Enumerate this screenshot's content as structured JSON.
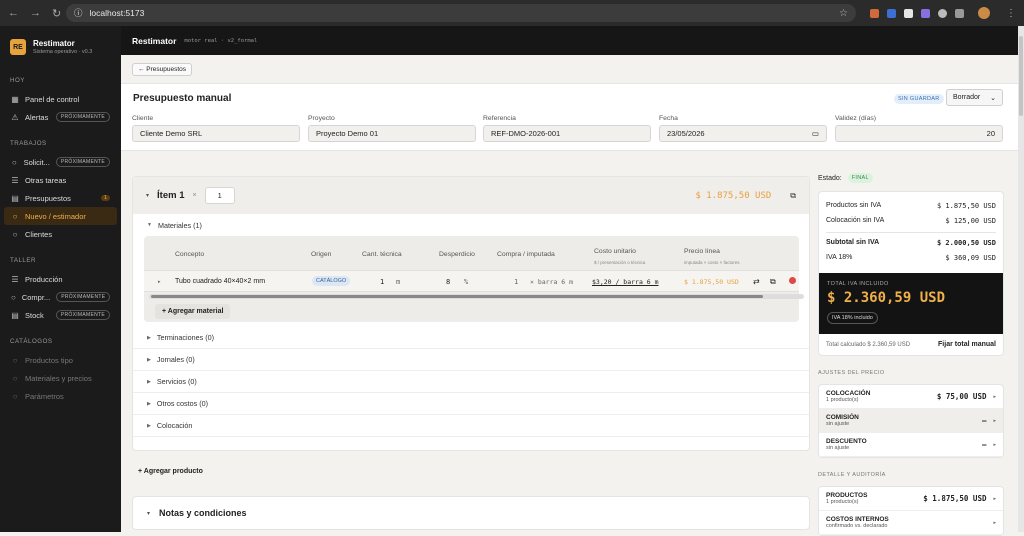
{
  "browser": {
    "url": "localhost:5173"
  },
  "sidebar": {
    "logo": "RE",
    "app_name": "Restimator",
    "app_sub": "Sistema operativo · v0.3",
    "sections": [
      {
        "title": "HOY",
        "items": [
          {
            "label": "Panel de control",
            "icon": "grid-icon",
            "state": "normal"
          },
          {
            "label": "Alertas",
            "icon": "alert-icon",
            "state": "normal",
            "pill": "PRÓXIMAMENTE"
          }
        ]
      },
      {
        "title": "TRABAJOS",
        "items": [
          {
            "label": "Solicit...",
            "icon": "circle-icon",
            "state": "normal",
            "pill": "PRÓXIMAMENTE"
          },
          {
            "label": "Otras tareas",
            "icon": "list-icon",
            "state": "normal"
          },
          {
            "label": "Presupuestos",
            "icon": "doc-icon",
            "state": "normal",
            "count": "1"
          },
          {
            "label": "Nuevo / estimador",
            "icon": "circle-icon",
            "state": "active"
          },
          {
            "label": "Clientes",
            "icon": "circle-icon",
            "state": "normal"
          }
        ]
      },
      {
        "title": "TALLER",
        "items": [
          {
            "label": "Producción",
            "icon": "list-icon",
            "state": "normal"
          },
          {
            "label": "Compr...",
            "icon": "circle-icon",
            "state": "normal",
            "pill": "PRÓXIMAMENTE"
          },
          {
            "label": "Stock",
            "icon": "doc-icon",
            "state": "normal",
            "pill": "PRÓXIMAMENTE"
          }
        ]
      },
      {
        "title": "CATÁLOGOS",
        "items": [
          {
            "label": "Productos tipo",
            "icon": "circle-icon",
            "state": "disabled"
          },
          {
            "label": "Materiales y precios",
            "icon": "circle-icon",
            "state": "disabled"
          },
          {
            "label": "Parámetros",
            "icon": "circle-icon",
            "state": "disabled"
          }
        ]
      }
    ]
  },
  "appbar": {
    "title": "Restimator",
    "sub": "motor real · v2_formal"
  },
  "main": {
    "back": "← Presupuestos",
    "title": "Presupuesto manual",
    "unsaved": "SIN GUARDAR",
    "status_select": "Borrador",
    "fields": {
      "cliente": {
        "label": "Cliente",
        "value": "Cliente Demo SRL"
      },
      "proyecto": {
        "label": "Proyecto",
        "value": "Proyecto Demo 01"
      },
      "referencia": {
        "label": "Referencia",
        "value": "REF-DMO-2026-001"
      },
      "fecha": {
        "label": "Fecha",
        "value": "23/05/2026"
      },
      "validez": {
        "label": "Validez (días)",
        "value": "20"
      }
    },
    "item": {
      "title": "Ítem 1",
      "qty": "1",
      "total": "$ 1.875,50 USD",
      "materials_title": "Materiales (1)",
      "columns": {
        "concepto": "Concepto",
        "origen": "Origen",
        "cant": "Cant. técnica",
        "desperdicio": "Desperdicio",
        "compra": "Compra / imputada",
        "costo": "Costo unitario",
        "costo_sub": "$ / presentación o técnica",
        "precio": "Precio línea",
        "precio_sub": "imputada × costo × factores"
      },
      "material_row": {
        "concepto": "Tubo cuadrado 40×40×2 mm",
        "origen": "CATÁLOGO",
        "cant": "1",
        "cant_unit": "m",
        "desperdicio": "8",
        "desp_unit": "%",
        "compra": "1",
        "compra_unit": "× barra 6 m",
        "costo": "$3,20 / barra 6 m",
        "precio": "$ 1.875,50 USD"
      },
      "add_material": "+ Agregar material",
      "sections": [
        "Terminaciones (0)",
        "Jornales (0)",
        "Servicios (0)",
        "Otros costos (0)",
        "Colocación"
      ]
    },
    "add_product": "+ Agregar producto",
    "notes": "Notas y condiciones"
  },
  "summary": {
    "estado_label": "Estado:",
    "estado": "FINAL",
    "lines": [
      {
        "label": "Productos sin IVA",
        "value": "$ 1.875,50 USD"
      },
      {
        "label": "Colocación sin IVA",
        "value": "$ 125,00 USD"
      }
    ],
    "subtotal": {
      "label": "Subtotal sin IVA",
      "value": "$ 2.000,50 USD"
    },
    "iva": {
      "label": "IVA 18%",
      "value": "$ 360,09 USD"
    },
    "total_label": "TOTAL IVA INCLUIDO",
    "total": "$ 2.360,59 USD",
    "iva_badge": "IVA 18% incluido",
    "calc": "Total calculado $ 2.360,59 USD",
    "fix": "Fijar total manual",
    "adjust_title": "AJUSTES DEL PRECIO",
    "adjustments": [
      {
        "name": "COLOCACIÓN",
        "sub": "1 producto(s)",
        "value": "$ 75,00 USD",
        "style": "plain"
      },
      {
        "name": "COMISIÓN",
        "sub": "sin ajuste",
        "value": "—",
        "style": "grey"
      },
      {
        "name": "DESCUENTO",
        "sub": "sin ajuste",
        "value": "—",
        "style": "plain"
      }
    ],
    "detail_title": "DETALLE Y AUDITORÍA",
    "details": [
      {
        "name": "PRODUCTOS",
        "sub": "1 producto(s)",
        "value": "$ 1.875,50 USD",
        "style": "plain"
      },
      {
        "name": "COSTOS INTERNOS",
        "sub": "confirmado vs. declarado",
        "value": "",
        "style": "plain"
      }
    ]
  }
}
